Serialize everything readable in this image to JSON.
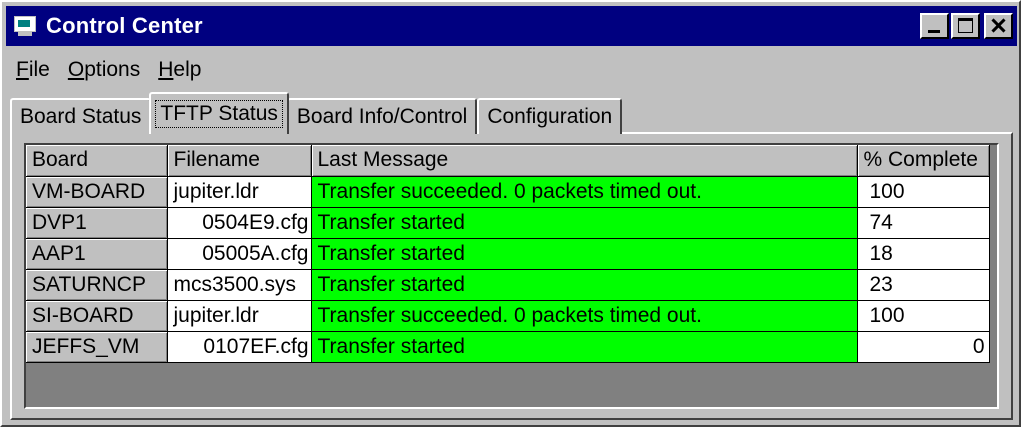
{
  "window": {
    "title": "Control Center",
    "controls": {
      "minimize": "minimize",
      "maximize": "maximize",
      "close": "close"
    }
  },
  "menu": [
    {
      "label_u": "F",
      "label_rest": "ile"
    },
    {
      "label_u": "O",
      "label_rest": "ptions"
    },
    {
      "label_u": "H",
      "label_rest": "elp"
    }
  ],
  "tabs": [
    {
      "label": "Board Status"
    },
    {
      "label": "TFTP Status"
    },
    {
      "label": "Board Info/Control"
    },
    {
      "label": "Configuration"
    }
  ],
  "active_tab": "TFTP Status",
  "grid": {
    "columns": [
      "Board",
      "Filename",
      "Last Message",
      "% Complete"
    ],
    "rows": [
      {
        "board": "VM-BOARD",
        "filename": "jupiter.ldr",
        "message": "Transfer succeeded. 0 packets timed out.",
        "percent": "100"
      },
      {
        "board": "DVP1",
        "filename": "0504E9.cfg",
        "message": "Transfer started",
        "percent": "74"
      },
      {
        "board": "AAP1",
        "filename": "05005A.cfg",
        "message": "Transfer started",
        "percent": "18"
      },
      {
        "board": "SATURNCP",
        "filename": "mcs3500.sys",
        "message": "Transfer started",
        "percent": "23"
      },
      {
        "board": "SI-BOARD",
        "filename": "jupiter.ldr",
        "message": "Transfer succeeded. 0 packets timed out.",
        "percent": "100"
      },
      {
        "board": "JEFFS_VM",
        "filename": "0107EF.cfg",
        "message": "Transfer started",
        "percent": "0"
      }
    ]
  },
  "colors": {
    "title_bar": "#000080",
    "message_cell": "#00ff00",
    "face": "#c0c0c0"
  }
}
